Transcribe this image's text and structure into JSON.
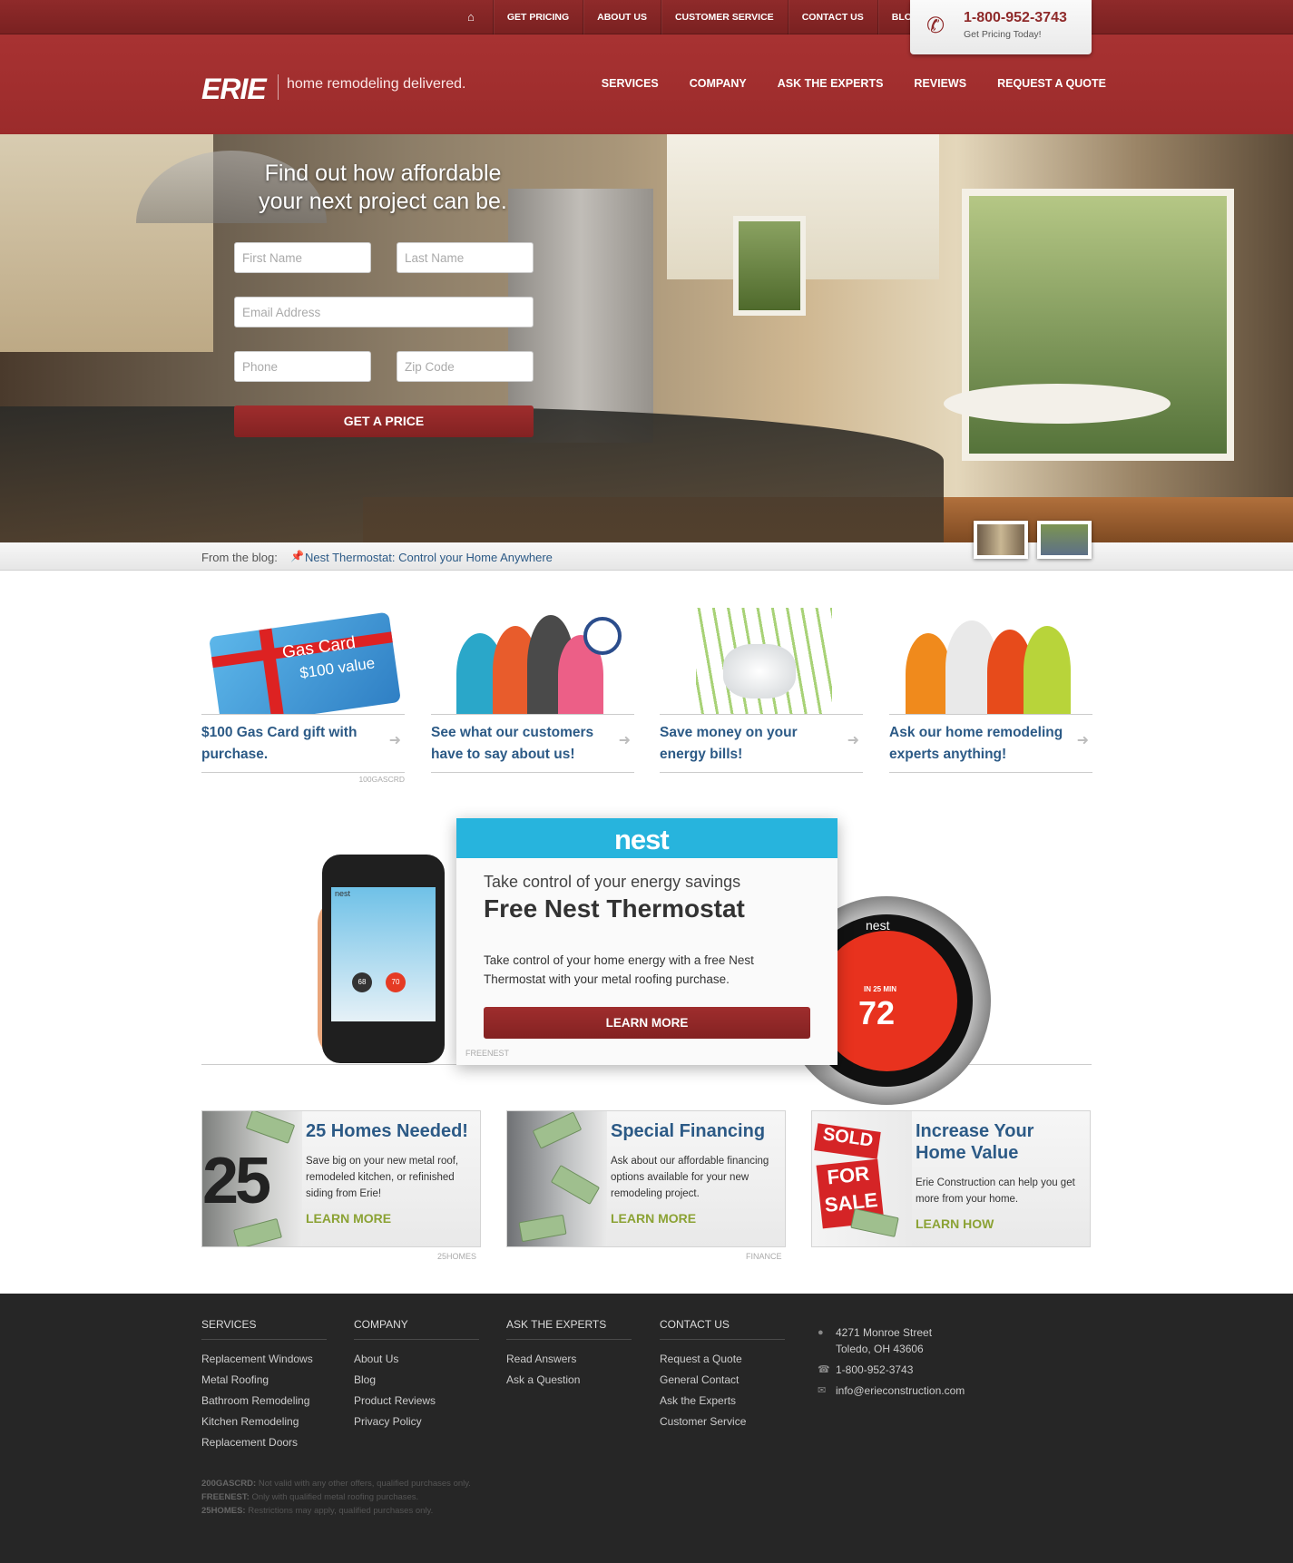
{
  "topnav": {
    "items": [
      "GET PRICING",
      "ABOUT US",
      "CUSTOMER SERVICE",
      "CONTACT US",
      "BLOG"
    ],
    "home_icon": "home-icon"
  },
  "phone_box": {
    "number": "1-800-952-3743",
    "subtext": "Get Pricing Today!",
    "icon": "phone-icon"
  },
  "header": {
    "logo": "ERIE",
    "tagline": "home remodeling delivered.",
    "nav": [
      "SERVICES",
      "COMPANY",
      "ASK THE EXPERTS",
      "REVIEWS",
      "REQUEST A QUOTE"
    ]
  },
  "hero": {
    "title_line1": "Find out how affordable",
    "title_line2": "your next project can be.",
    "form": {
      "first_name_placeholder": "First Name",
      "last_name_placeholder": "Last Name",
      "email_placeholder": "Email Address",
      "phone_placeholder": "Phone",
      "zip_placeholder": "Zip Code",
      "submit_label": "GET A PRICE"
    }
  },
  "blogbar": {
    "label": "From the blog:",
    "pin_icon": "pin-icon",
    "link": "Nest Thermostat: Control your Home Anywhere"
  },
  "features": [
    {
      "title": "$100 Gas Card gift with purchase.",
      "code": "100GASCRD",
      "card_line1": "Gas Card",
      "card_line2": "$100 value"
    },
    {
      "title": "See what our customers have to say about us!",
      "code": ""
    },
    {
      "title": "Save money on your energy bills!",
      "code": ""
    },
    {
      "title": "Ask our home remodeling experts anything!",
      "code": ""
    }
  ],
  "nest": {
    "logo": "nest",
    "subtitle": "Take control of your energy savings",
    "title": "Free Nest Thermostat",
    "body": "Take control of your home energy with a free Nest Thermostat with your metal roofing purchase.",
    "button": "LEARN MORE",
    "code": "FREENEST",
    "thermostat_brand": "nest",
    "thermostat_note": "IN 25 MIN",
    "thermostat_temp": "72",
    "phone_app_label": "nest",
    "phone_temp_a": "68",
    "phone_temp_b": "70"
  },
  "promos": [
    {
      "title": "25 Homes Needed!",
      "body": "Save big on your new metal roof, remodeled kitchen, or refinished siding from Erie!",
      "link": "LEARN MORE",
      "code": "25HOMES",
      "image_text": "25"
    },
    {
      "title": "Special Financing",
      "body": "Ask about our affordable financing options available for your new remodeling project.",
      "link": "LEARN MORE",
      "code": "FINANCE"
    },
    {
      "title": "Increase Your Home Value",
      "body": "Erie Construction can help you get more from your home.",
      "link": "LEARN HOW",
      "code": "",
      "sign_sold": "SOLD",
      "sign_for": "FOR",
      "sign_sale": "SALE"
    }
  ],
  "footer": {
    "columns": [
      {
        "heading": "SERVICES",
        "links": [
          "Replacement Windows",
          "Metal Roofing",
          "Bathroom Remodeling",
          "Kitchen Remodeling",
          "Replacement Doors"
        ]
      },
      {
        "heading": "COMPANY",
        "links": [
          "About Us",
          "Blog",
          "Product Reviews",
          "Privacy Policy"
        ]
      },
      {
        "heading": "ASK THE EXPERTS",
        "links": [
          "Read Answers",
          "Ask a Question"
        ]
      },
      {
        "heading": "CONTACT US",
        "links": [
          "Request a Quote",
          "General Contact",
          "Ask the Experts",
          "Customer Service"
        ]
      }
    ],
    "contact": {
      "address_line1": "4271 Monroe Street",
      "address_line2": "Toledo, OH 43606",
      "phone": "1-800-952-3743",
      "email": "info@erieconstruction.com"
    },
    "disclaimers": [
      {
        "code": "200GASCRD:",
        "text": "Not valid with any other offers, qualified purchases only."
      },
      {
        "code": "FREENEST:",
        "text": "Only with qualified metal roofing purchases."
      },
      {
        "code": "25HOMES:",
        "text": "Restrictions may apply, qualified purchases only."
      }
    ]
  },
  "colors": {
    "brand_red": "#9b2b2b",
    "link_blue": "#2c5a86",
    "nest_blue": "#27b4dd",
    "promo_green": "#8ba234",
    "footer_bg": "#262626"
  }
}
